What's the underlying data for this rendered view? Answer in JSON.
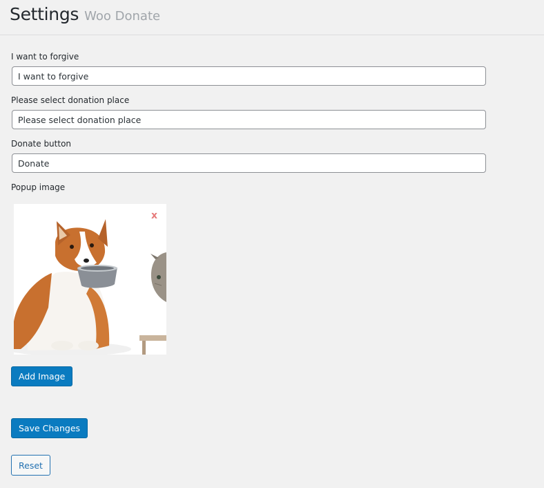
{
  "header": {
    "title": "Settings",
    "subtitle": "Woo Donate"
  },
  "form": {
    "forgive": {
      "label": "I want to forgive",
      "value": "I want to forgive"
    },
    "place": {
      "label": "Please select donation place",
      "value": "Please select donation place"
    },
    "donate_button": {
      "label": "Donate button",
      "value": "Donate"
    },
    "popup_image": {
      "label": "Popup image",
      "remove_glyph": "x",
      "image_subject": "dog-with-bowl-and-cat"
    }
  },
  "buttons": {
    "add_image": "Add Image",
    "save": "Save Changes",
    "reset": "Reset"
  },
  "colors": {
    "background": "#f1f1f1",
    "primary": "#0a7bc0",
    "secondary_text": "#2271b1",
    "remove": "#e67b7b"
  }
}
